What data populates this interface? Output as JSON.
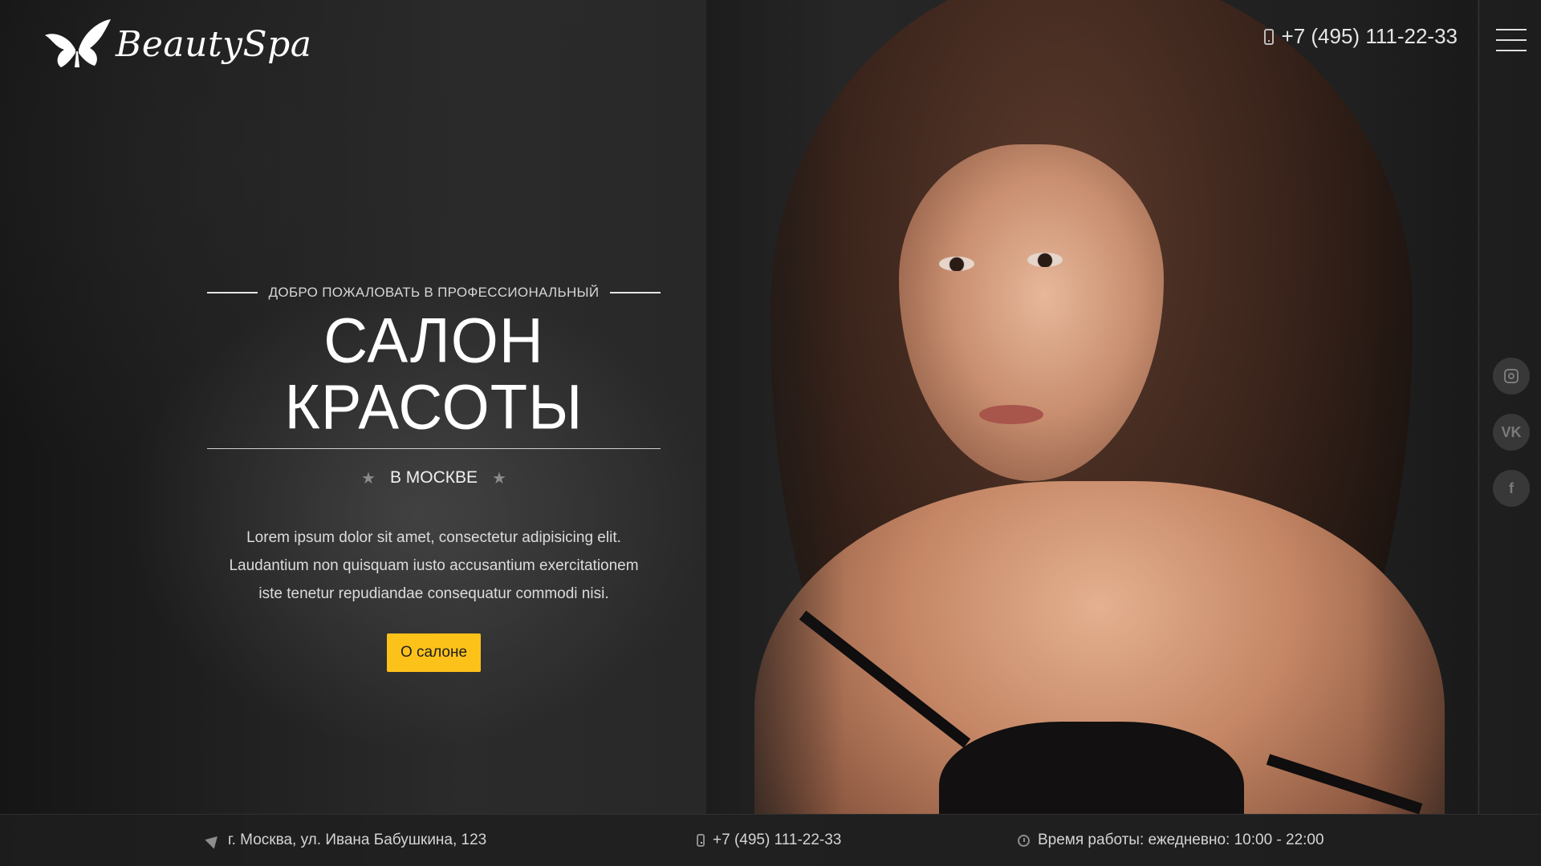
{
  "brand": {
    "logo_text": "BeautySpa",
    "logo_icon": "butterfly-icon"
  },
  "header": {
    "phone": "+7 (495) 111-22-33",
    "phone_icon": "mobile-phone-icon",
    "menu_icon": "hamburger-menu-icon"
  },
  "hero": {
    "welcome": "ДОБРО ПОЖАЛОВАТЬ В ПРОФЕССИОНАЛЬНЫЙ",
    "title": "САЛОН КРАСОТЫ",
    "city": "В МОСКВЕ",
    "description_lines": [
      "Lorem ipsum dolor sit amet, consectetur adipisicing elit.",
      "Laudantium non quisquam iusto accusantium exercitationem",
      "iste tenetur repudiandae consequatur commodi nisi."
    ],
    "cta_label": "О салоне"
  },
  "social": [
    {
      "name": "instagram",
      "icon": "instagram-icon"
    },
    {
      "name": "vk",
      "icon": "vk-icon",
      "glyph": "VK"
    },
    {
      "name": "facebook",
      "icon": "facebook-icon",
      "glyph": "f"
    }
  ],
  "footer_bar": {
    "address": "г. Москва, ул. Ивана Бабушкина, 123",
    "phone": "+7 (495) 111-22-33",
    "hours": "Время работы: ежедневно: 10:00 - 22:00"
  },
  "colors": {
    "accent": "#fdc21a",
    "background": "#1a1a1a",
    "text": "#ffffff"
  }
}
